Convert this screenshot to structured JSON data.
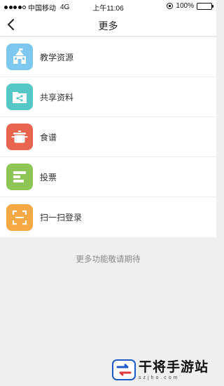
{
  "status_bar": {
    "carrier": "中国移动",
    "network": "4G",
    "time": "上午11:06",
    "battery": "100%",
    "battery_level": 1.0
  },
  "header": {
    "title": "更多",
    "back_icon": "chevron-left-icon"
  },
  "menu": [
    {
      "label": "教学资源",
      "icon": "school-building-icon",
      "color": "#7ec8f0"
    },
    {
      "label": "共享资料",
      "icon": "shared-folder-icon",
      "color": "#56c7c7"
    },
    {
      "label": "食谱",
      "icon": "cooking-pot-icon",
      "color": "#e8664f"
    },
    {
      "label": "投票",
      "icon": "vote-bars-icon",
      "color": "#8ec554"
    },
    {
      "label": "扫一扫登录",
      "icon": "scan-frame-icon",
      "color": "#f5a843"
    }
  ],
  "footer_note": "更多功能敬请期待",
  "watermark": {
    "title": "干将手游站",
    "subtitle": "szjho.com"
  }
}
